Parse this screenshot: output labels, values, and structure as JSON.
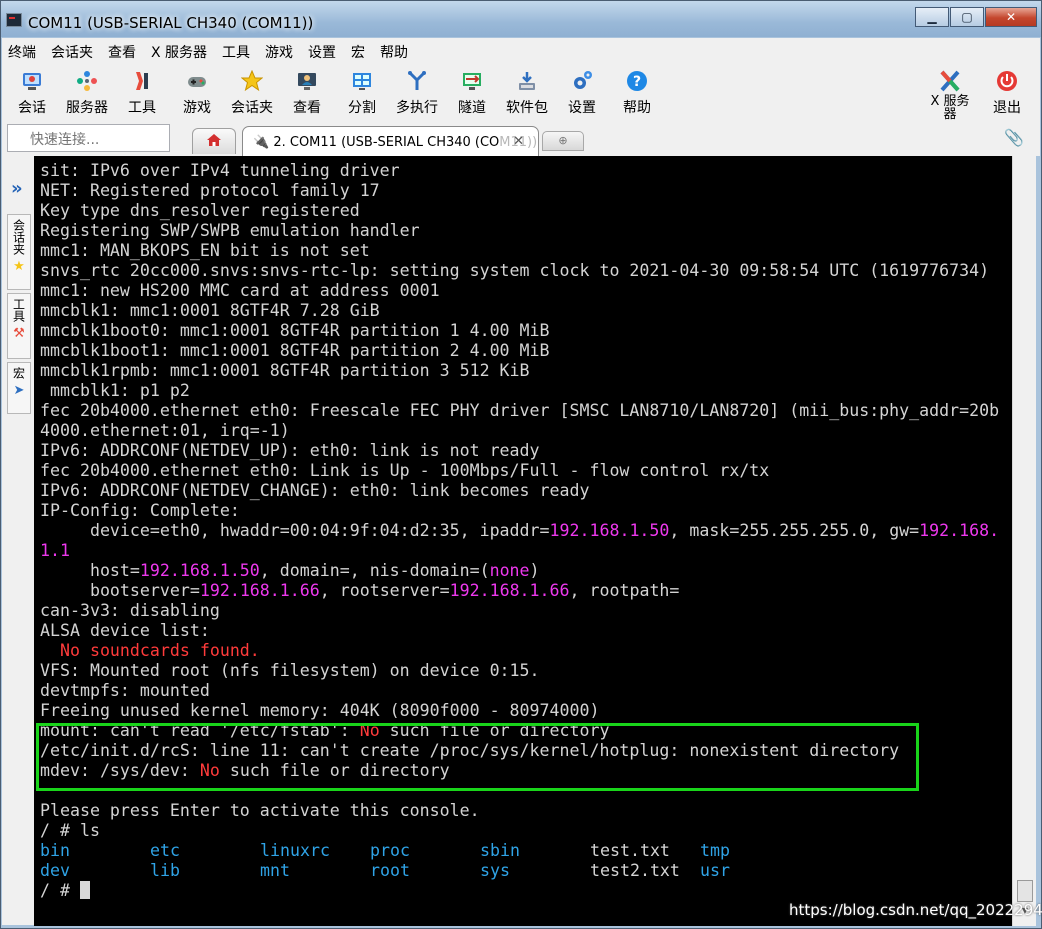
{
  "window": {
    "title": "COM11  (USB-SERIAL CH340 (COM11))"
  },
  "window_buttons": {
    "minimize": "▁",
    "maximize": "▢",
    "close": "✕"
  },
  "menu": [
    "终端",
    "会话夹",
    "查看",
    "X 服务器",
    "工具",
    "游戏",
    "设置",
    "宏",
    "帮助"
  ],
  "toolbar": {
    "left": [
      {
        "label": "会话",
        "icon": "session-icon"
      },
      {
        "label": "服务器",
        "icon": "servers-icon"
      },
      {
        "label": "工具",
        "icon": "tools-icon"
      },
      {
        "label": "游戏",
        "icon": "games-icon"
      },
      {
        "label": "会话夹",
        "icon": "star-icon"
      },
      {
        "label": "查看",
        "icon": "view-icon"
      },
      {
        "label": "分割",
        "icon": "split-icon"
      },
      {
        "label": "多执行",
        "icon": "multiexec-icon"
      },
      {
        "label": "隧道",
        "icon": "tunnel-icon"
      },
      {
        "label": "软件包",
        "icon": "packages-icon"
      },
      {
        "label": "设置",
        "icon": "settings-icon"
      },
      {
        "label": "帮助",
        "icon": "help-icon"
      }
    ],
    "right": [
      {
        "label": "X 服务器",
        "icon": "x-server-icon"
      },
      {
        "label": "退出",
        "icon": "power-icon"
      }
    ]
  },
  "quick_connect": {
    "placeholder": "快速连接..."
  },
  "tabs": {
    "active": {
      "label_visible": "2. COM11  (USB-SERIAL CH340 (CO",
      "label_faded": "M11))"
    }
  },
  "side_tabs": [
    "会话夹",
    "工具",
    "宏"
  ],
  "terminal": {
    "lines": [
      [
        {
          "t": "sit: IPv6 over IPv4 tunneling driver"
        }
      ],
      [
        {
          "t": "NET: Registered protocol family 17"
        }
      ],
      [
        {
          "t": "Key type dns_resolver registered"
        }
      ],
      [
        {
          "t": "Registering SWP/SWPB emulation handler"
        }
      ],
      [
        {
          "t": "mmc1: MAN_BKOPS_EN bit is not set"
        }
      ],
      [
        {
          "t": "snvs_rtc 20cc000.snvs:snvs-rtc-lp: setting system clock to 2021-04-30 09:58:54 UTC (1619776734)"
        }
      ],
      [
        {
          "t": "mmc1: new HS200 MMC card at address 0001"
        }
      ],
      [
        {
          "t": "mmcblk1: mmc1:0001 8GTF4R 7.28 GiB"
        }
      ],
      [
        {
          "t": "mmcblk1boot0: mmc1:0001 8GTF4R partition 1 4.00 MiB"
        }
      ],
      [
        {
          "t": "mmcblk1boot1: mmc1:0001 8GTF4R partition 2 4.00 MiB"
        }
      ],
      [
        {
          "t": "mmcblk1rpmb: mmc1:0001 8GTF4R partition 3 512 KiB"
        }
      ],
      [
        {
          "t": " mmcblk1: p1 p2"
        }
      ],
      [
        {
          "t": "fec 20b4000.ethernet eth0: Freescale FEC PHY driver [SMSC LAN8710/LAN8720] (mii_bus:phy_addr=20b"
        }
      ],
      [
        {
          "t": "4000.ethernet:01, irq=-1)"
        }
      ],
      [
        {
          "t": "IPv6: ADDRCONF(NETDEV_UP): eth0: link is not ready"
        }
      ],
      [
        {
          "t": "fec 20b4000.ethernet eth0: Link is Up - 100Mbps/Full - flow control rx/tx"
        }
      ],
      [
        {
          "t": "IPv6: ADDRCONF(NETDEV_CHANGE): eth0: link becomes ready"
        }
      ],
      [
        {
          "t": "IP-Config: Complete:"
        }
      ],
      [
        {
          "t": "     device=eth0, hwaddr=00:04:9f:04:d2:35, ipaddr="
        },
        {
          "t": "192.168.1.50",
          "c": "ip"
        },
        {
          "t": ", mask=255.255.255.0, gw="
        },
        {
          "t": "192.168.",
          "c": "ip"
        }
      ],
      [
        {
          "t": "1.1",
          "c": "ip"
        }
      ],
      [
        {
          "t": "     host="
        },
        {
          "t": "192.168.1.50",
          "c": "ip"
        },
        {
          "t": ", domain=, nis-domain=("
        },
        {
          "t": "none",
          "c": "ip"
        },
        {
          "t": ")"
        }
      ],
      [
        {
          "t": "     bootserver="
        },
        {
          "t": "192.168.1.66",
          "c": "ip"
        },
        {
          "t": ", rootserver="
        },
        {
          "t": "192.168.1.66",
          "c": "ip"
        },
        {
          "t": ", rootpath="
        }
      ],
      [
        {
          "t": "can-3v3: disabling"
        }
      ],
      [
        {
          "t": "ALSA device list:"
        }
      ],
      [
        {
          "t": "  "
        },
        {
          "t": "No soundcards found.",
          "c": "red"
        }
      ],
      [
        {
          "t": "VFS: Mounted root (nfs filesystem) on device 0:15."
        }
      ],
      [
        {
          "t": "devtmpfs: mounted"
        }
      ],
      [
        {
          "t": "Freeing unused kernel memory: 404K (8090f000 - 80974000)"
        }
      ],
      [
        {
          "t": "mount: can't read '/etc/fstab': "
        },
        {
          "t": "No",
          "c": "red"
        },
        {
          "t": " such file or directory"
        }
      ],
      [
        {
          "t": "/etc/init.d/rcS: line 11: can't create /proc/sys/kernel/hotplug: nonexistent directory"
        }
      ],
      [
        {
          "t": "mdev: /sys/dev: "
        },
        {
          "t": "No",
          "c": "red"
        },
        {
          "t": " such file or directory"
        }
      ],
      [
        {
          "t": ""
        }
      ],
      [
        {
          "t": "Please press Enter to activate this console."
        }
      ],
      [
        {
          "t": "/ # ls"
        }
      ]
    ],
    "ls_rows": [
      [
        "bin",
        "etc",
        "linuxrc",
        "proc",
        "sbin",
        "test.txt",
        "tmp"
      ],
      [
        "dev",
        "lib",
        "mnt",
        "root",
        "sys",
        "test2.txt",
        "usr"
      ]
    ],
    "ls_dirs": [
      "bin",
      "etc",
      "linuxrc",
      "proc",
      "sbin",
      "tmp",
      "dev",
      "lib",
      "mnt",
      "root",
      "sys",
      "usr"
    ],
    "prompt": "/ # "
  },
  "watermark": "https://blog.csdn.net/qq_2022294",
  "colors": {
    "ip": "#ee38ee",
    "error": "#ff3b3b",
    "dir": "#2fa3e6",
    "highlight_box": "#19d41a"
  }
}
